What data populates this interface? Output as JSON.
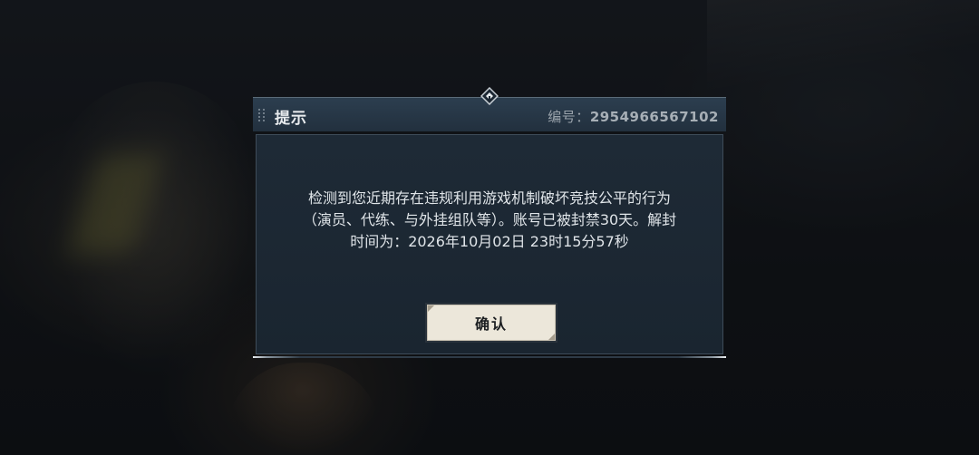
{
  "dialog": {
    "title": "提示",
    "serial_label": "编号：",
    "serial_number": "2954966567102",
    "message_lines": [
      "检测到您近期存在违规利用游戏机制破坏竞技公平的行为",
      "（演员、代练、与外挂组队等）。账号已被封禁30天。解封",
      "时间为：2026年10月02日 23时15分57秒"
    ],
    "confirm_label": "确认"
  },
  "icons": {
    "title_grip": "grip-dots-icon",
    "top_ornament": "diamond-ornament-icon"
  },
  "colors": {
    "title_bar": "#2c3e4f",
    "body": "#1e2a36",
    "button": "#ece7da",
    "text": "#dfe4e8"
  }
}
